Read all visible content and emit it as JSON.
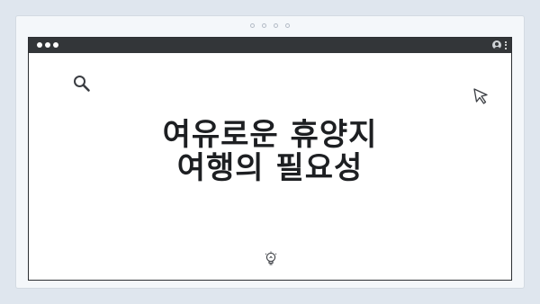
{
  "headline": {
    "line1": "여유로운 휴양지",
    "line2": "여행의 필요성"
  },
  "icons": {
    "search": "search-icon",
    "cursor": "cursor-icon",
    "bulb": "lightbulb-icon",
    "user": "user-icon",
    "menu": "kebab-menu-icon"
  },
  "colors": {
    "background": "#dfe6ee",
    "title_bar": "#333639",
    "headline": "#1d1f22"
  }
}
